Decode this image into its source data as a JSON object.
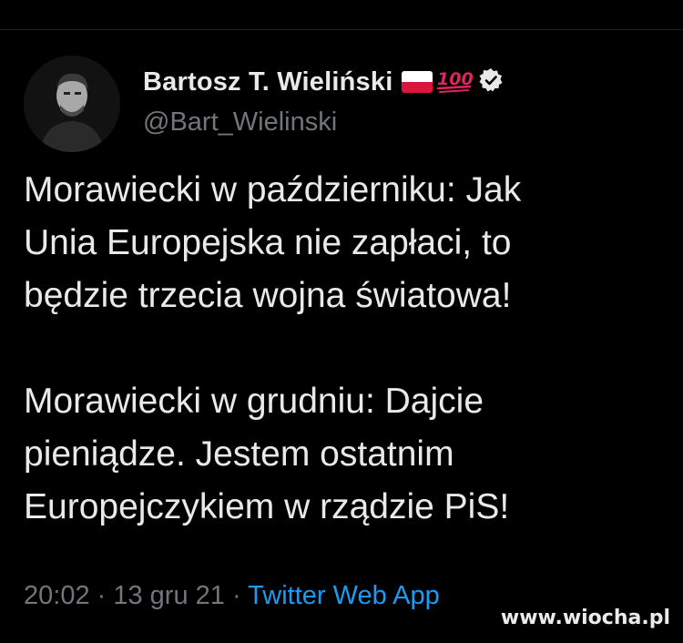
{
  "author": {
    "display_name": "Bartosz T. Wieliński",
    "hundred_emoji_text": "100",
    "handle": "@Bart_Wielinski"
  },
  "tweet": {
    "paragraphs": [
      "Morawiecki w październiku: Jak\nUnia Europejska nie zapłaci, to\nbędzie trzecia wojna światowa!",
      "Morawiecki w grudniu: Dajcie\npieniądze. Jestem ostatnim\nEuropejczykiem w rządzie PiS!"
    ],
    "time": "20:02",
    "separator": " · ",
    "date": "13 gru 21",
    "source": "Twitter Web App"
  },
  "watermark": "www.wiocha.pl",
  "icons": {
    "flag": "poland-flag-icon",
    "hundred": "hundred-points-icon",
    "verified": "verified-badge-icon"
  },
  "colors": {
    "background": "#000000",
    "text": "#e7e9ea",
    "muted": "#71767b",
    "link": "#1d9bf0",
    "flag_white": "#ffffff",
    "flag_red": "#dc143c",
    "hundred_red": "#e0245e"
  }
}
